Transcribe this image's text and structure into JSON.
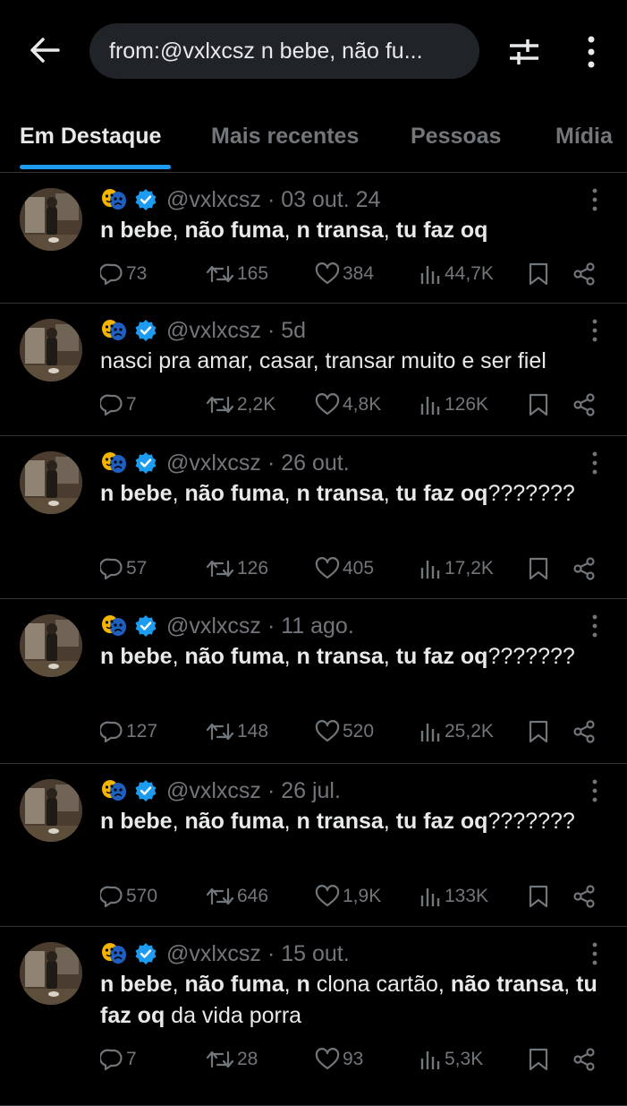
{
  "header": {
    "search_query": "from:@vxlxcsz n bebe, não fu..."
  },
  "tabs": [
    {
      "label": "Em Destaque"
    },
    {
      "label": "Mais recentes"
    },
    {
      "label": "Pessoas"
    },
    {
      "label": "Mídia"
    }
  ],
  "icons": {
    "back": "arrow-left-icon",
    "filter": "sliders-icon",
    "more": "more-vertical-icon",
    "verified": "verified-badge-icon",
    "emoji": "performing-arts-emoji-icon"
  },
  "colors": {
    "accent": "#1d9bf0",
    "background": "#000000",
    "muted": "#71767b",
    "text": "#e7e9ea"
  },
  "tweets": [
    {
      "handle": "@vxlxcsz",
      "date": "· 03 out. 24",
      "text_parts": [
        {
          "t": "n bebe",
          "b": true
        },
        {
          "t": ", ",
          "b": false
        },
        {
          "t": "não fuma",
          "b": true
        },
        {
          "t": ", ",
          "b": false
        },
        {
          "t": "n transa",
          "b": true
        },
        {
          "t": ", ",
          "b": false
        },
        {
          "t": "tu faz oq",
          "b": true
        }
      ],
      "replies": "73",
      "retweets": "165",
      "likes": "384",
      "views": "44,7K"
    },
    {
      "handle": "@vxlxcsz",
      "date": "· 5d",
      "text_parts": [
        {
          "t": "nasci pra amar, casar, transar muito e ser fiel",
          "b": false
        }
      ],
      "replies": "7",
      "retweets": "2,2K",
      "likes": "4,8K",
      "views": "126K"
    },
    {
      "handle": "@vxlxcsz",
      "date": "· 26 out.",
      "text_parts": [
        {
          "t": "n bebe",
          "b": true
        },
        {
          "t": ", ",
          "b": false
        },
        {
          "t": "não fuma",
          "b": true
        },
        {
          "t": ", ",
          "b": false
        },
        {
          "t": "n transa",
          "b": true
        },
        {
          "t": ", ",
          "b": false
        },
        {
          "t": "tu faz oq",
          "b": true
        },
        {
          "t": "???????",
          "b": false
        }
      ],
      "replies": "57",
      "retweets": "126",
      "likes": "405",
      "views": "17,2K"
    },
    {
      "handle": "@vxlxcsz",
      "date": "· 11 ago.",
      "text_parts": [
        {
          "t": "n bebe",
          "b": true
        },
        {
          "t": ", ",
          "b": false
        },
        {
          "t": "não fuma",
          "b": true
        },
        {
          "t": ", ",
          "b": false
        },
        {
          "t": "n transa",
          "b": true
        },
        {
          "t": ", ",
          "b": false
        },
        {
          "t": "tu faz oq",
          "b": true
        },
        {
          "t": "???????",
          "b": false
        }
      ],
      "replies": "127",
      "retweets": "148",
      "likes": "520",
      "views": "25,2K"
    },
    {
      "handle": "@vxlxcsz",
      "date": "· 26 jul.",
      "text_parts": [
        {
          "t": "n bebe",
          "b": true
        },
        {
          "t": ", ",
          "b": false
        },
        {
          "t": "não fuma",
          "b": true
        },
        {
          "t": ", ",
          "b": false
        },
        {
          "t": "n transa",
          "b": true
        },
        {
          "t": ", ",
          "b": false
        },
        {
          "t": "tu faz oq",
          "b": true
        },
        {
          "t": "???????",
          "b": false
        }
      ],
      "replies": "570",
      "retweets": "646",
      "likes": "1,9K",
      "views": "133K"
    },
    {
      "handle": "@vxlxcsz",
      "date": "· 15 out.",
      "text_parts": [
        {
          "t": "n bebe",
          "b": true
        },
        {
          "t": ", ",
          "b": false
        },
        {
          "t": "não fuma",
          "b": true
        },
        {
          "t": ", ",
          "b": false
        },
        {
          "t": "n",
          "b": true
        },
        {
          "t": " clona cartão, ",
          "b": false
        },
        {
          "t": "não transa",
          "b": true
        },
        {
          "t": ", ",
          "b": false
        },
        {
          "t": "tu faz oq",
          "b": true
        },
        {
          "t": " da vida porra",
          "b": false
        }
      ],
      "replies": "7",
      "retweets": "28",
      "likes": "93",
      "views": "5,3K"
    }
  ]
}
